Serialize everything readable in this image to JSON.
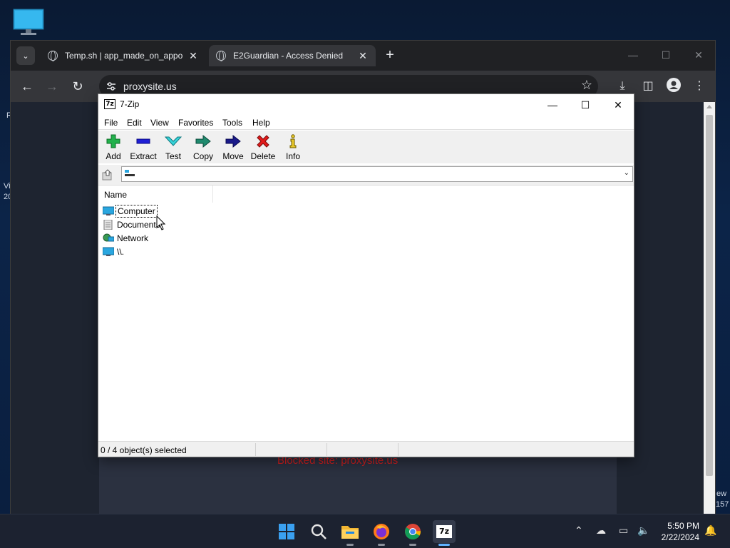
{
  "desktop": {
    "edge_labels": [
      "R",
      "Vi",
      "20",
      "ew",
      "157"
    ]
  },
  "browser": {
    "tabs": [
      {
        "title": "Temp.sh | app_made_on_appor",
        "close": "✕",
        "active": false
      },
      {
        "title": "E2Guardian - Access Denied",
        "close": "✕",
        "active": true
      }
    ],
    "new_tab": "+",
    "address": "proxysite.us",
    "blocked_text": "Blocked site: proxysite.us",
    "partial_text": "... ... ..."
  },
  "sevenzip": {
    "title": "7-Zip",
    "menu": [
      "File",
      "Edit",
      "View",
      "Favorites",
      "Tools",
      "Help"
    ],
    "toolbar": [
      {
        "label": "Add",
        "icon": "add-icon"
      },
      {
        "label": "Extract",
        "icon": "extract-icon"
      },
      {
        "label": "Test",
        "icon": "test-icon"
      },
      {
        "label": "Copy",
        "icon": "copy-icon"
      },
      {
        "label": "Move",
        "icon": "move-icon"
      },
      {
        "label": "Delete",
        "icon": "delete-icon"
      },
      {
        "label": "Info",
        "icon": "info-icon"
      }
    ],
    "address_value": "",
    "column_name": "Name",
    "items": [
      {
        "name": "Computer",
        "icon": "computer-icon",
        "focused": true
      },
      {
        "name": "Documents",
        "icon": "documents-icon",
        "focused": false
      },
      {
        "name": "Network",
        "icon": "network-icon",
        "focused": false
      },
      {
        "name": "\\\\.",
        "icon": "computer-icon",
        "focused": false
      }
    ],
    "status": "0 / 4 object(s) selected"
  },
  "taskbar": {
    "time": "5:50 PM",
    "date": "2/22/2024"
  },
  "colors": {
    "chrome_bg": "#202124",
    "blocked_red": "#d21f1f",
    "accent_blue": "#5fb2ff"
  }
}
